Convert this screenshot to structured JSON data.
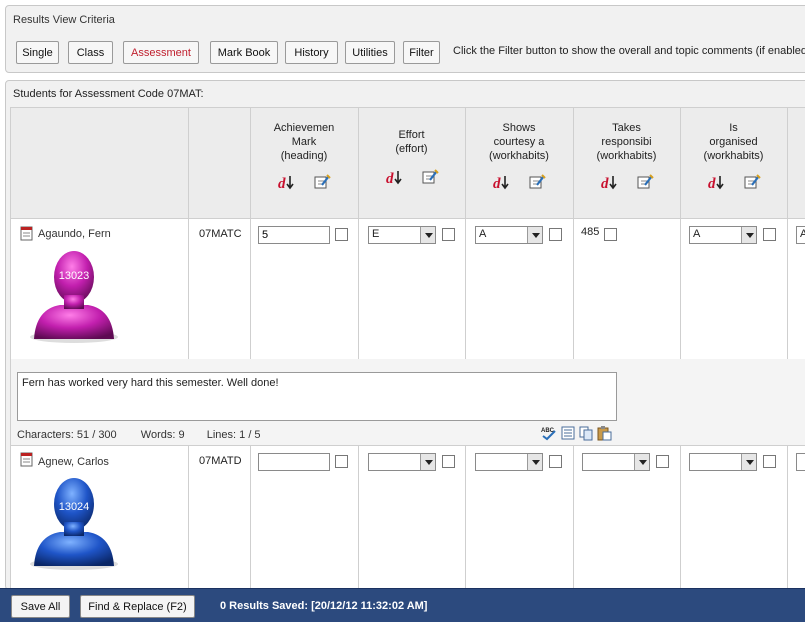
{
  "criteria": {
    "title": "Results View Criteria",
    "buttons": [
      "Single",
      "Class",
      "Assessment",
      "Mark Book",
      "History",
      "Utilities",
      "Filter"
    ],
    "active": "Assessment",
    "hint": "Click the Filter button to show the overall and topic comments (if enabled)"
  },
  "students_panel": {
    "title": "Students for Assessment Code 07MAT:"
  },
  "columns": [
    {
      "line1": "Achievemen",
      "line2": "Mark",
      "line3": "(heading)"
    },
    {
      "line1": "Effort",
      "line2": "(effort)",
      "line3": ""
    },
    {
      "line1": "Shows",
      "line2": "courtesy a",
      "line3": "(workhabits)"
    },
    {
      "line1": "Takes",
      "line2": "responsibi",
      "line3": "(workhabits)"
    },
    {
      "line1": "Is",
      "line2": "organised",
      "line3": "(workhabits)"
    }
  ],
  "students": [
    {
      "name": "Agaundo, Fern",
      "code": "07MATC",
      "avatar_number": "13023",
      "avatar_color": "#c21fae",
      "mark": "5",
      "effort": "E",
      "courtesy": "A",
      "responsibility": "485",
      "organised": "A",
      "next": "A",
      "comment": "Fern has worked very hard this semester. Well done!",
      "characters": "Characters: 51  /  300",
      "words": "Words: 9",
      "lines": "Lines: 1 /  5"
    },
    {
      "name": "Agnew, Carlos",
      "code": "07MATD",
      "avatar_number": "13024",
      "avatar_color": "#1f55c8",
      "mark": "",
      "effort": "",
      "courtesy": "",
      "responsibility": "",
      "organised": "",
      "next": ""
    }
  ],
  "footer": {
    "save_all": "Save All",
    "find_replace": "Find & Replace (F2)",
    "status": "0 Results Saved: [20/12/12 11:32:02 AM]"
  },
  "icons": {
    "sort": "sort-descending-icon",
    "edit": "edit-column-icon",
    "spell": "spell-check-icon",
    "report": "report-icon"
  }
}
